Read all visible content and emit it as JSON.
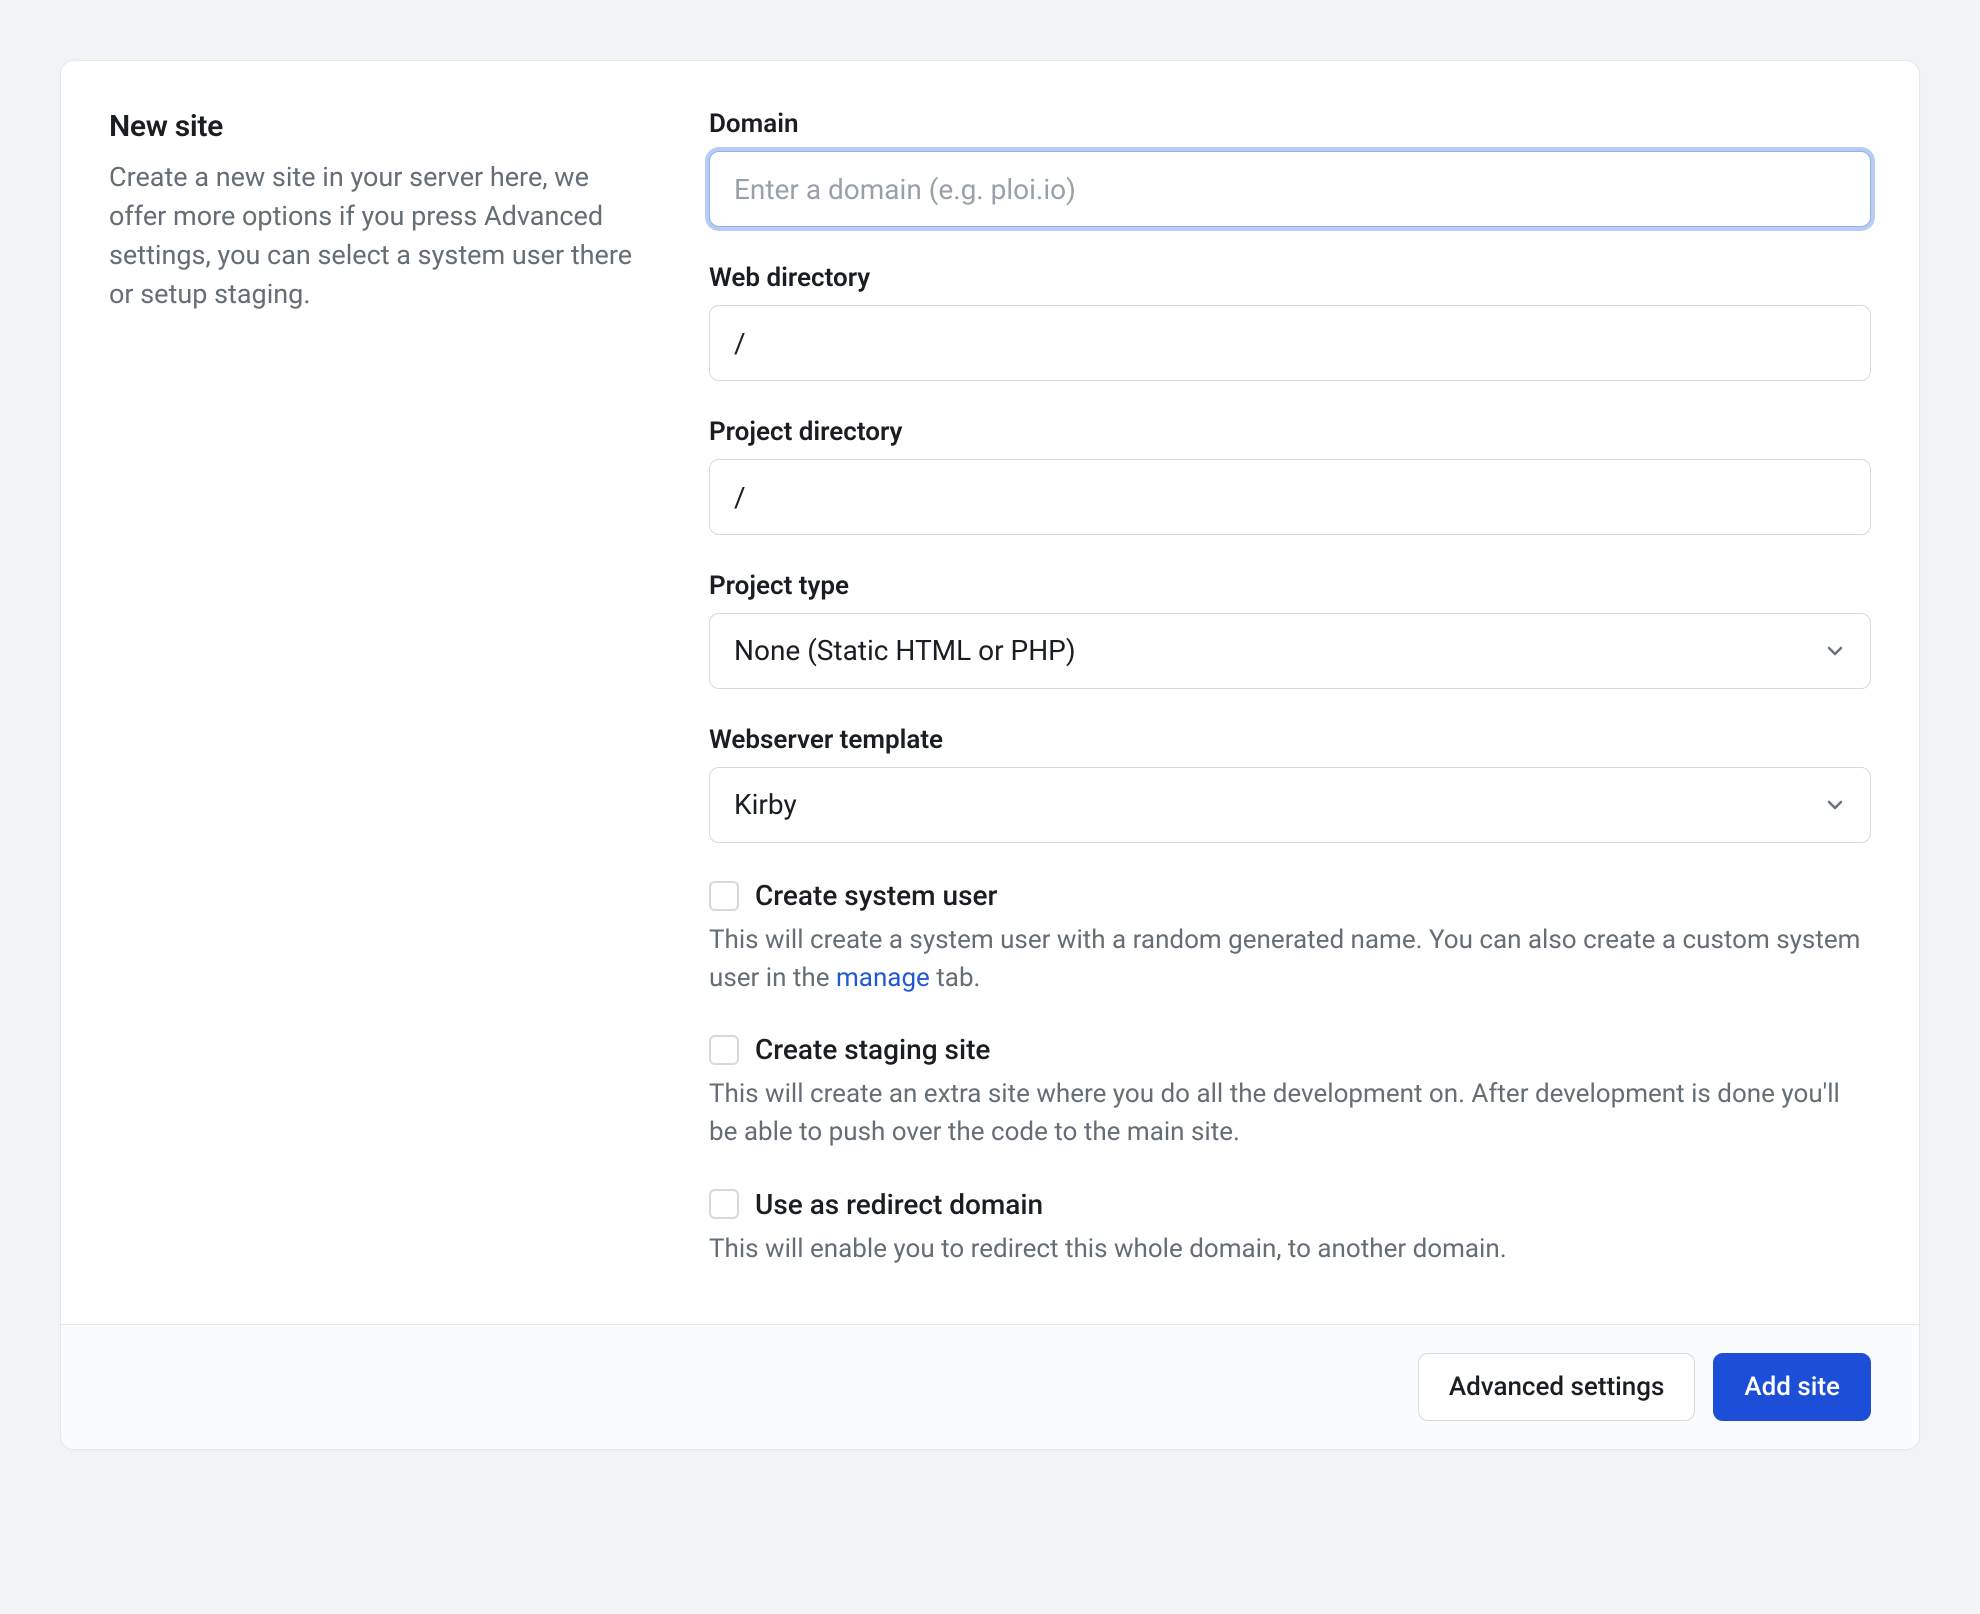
{
  "side": {
    "title": "New site",
    "description": "Create a new site in your server here, we offer more options if you press Advanced settings, you can select a system user there or setup staging."
  },
  "form": {
    "domain": {
      "label": "Domain",
      "placeholder": "Enter a domain (e.g. ploi.io)",
      "value": ""
    },
    "web_directory": {
      "label": "Web directory",
      "value": "/"
    },
    "project_directory": {
      "label": "Project directory",
      "value": "/"
    },
    "project_type": {
      "label": "Project type",
      "value": "None (Static HTML or PHP)"
    },
    "webserver_template": {
      "label": "Webserver template",
      "value": "Kirby"
    },
    "create_system_user": {
      "label": "Create system user",
      "checked": false,
      "help_pre": "This will create a system user with a random generated name. You can also create a custom system user in the ",
      "help_link": "manage",
      "help_post": " tab."
    },
    "create_staging": {
      "label": "Create staging site",
      "checked": false,
      "help": "This will create an extra site where you do all the development on. After development is done you'll be able to push over the code to the main site."
    },
    "redirect_domain": {
      "label": "Use as redirect domain",
      "checked": false,
      "help": "This will enable you to redirect this whole domain, to another domain."
    }
  },
  "footer": {
    "advanced": "Advanced settings",
    "submit": "Add site"
  }
}
